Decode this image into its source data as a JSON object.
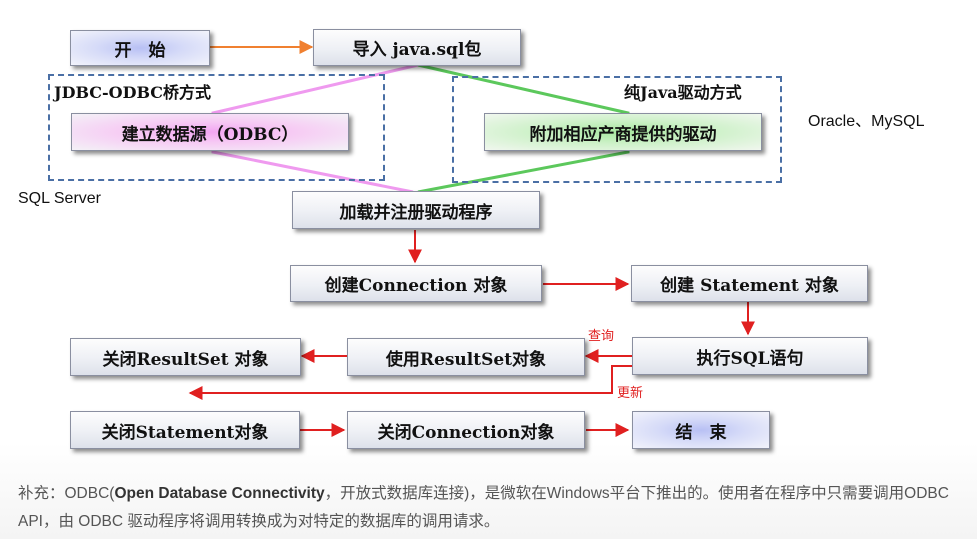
{
  "nodes": {
    "start": "开　始",
    "import": "导入 java.sql包",
    "odbc_source": "建立数据源（ODBC）",
    "vendor_driver": "附加相应产商提供的驱动",
    "load_driver": "加载并注册驱动程序",
    "create_connection": "创建Connection 对象",
    "create_statement": "创建 Statement 对象",
    "execute_sql": "执行SQL语句",
    "use_resultset": "使用ResultSet对象",
    "close_resultset": "关闭ResultSet 对象",
    "close_statement": "关闭Statement对象",
    "close_connection": "关闭Connection对象",
    "end": "结　束"
  },
  "groups": {
    "jdbc_odbc": "JDBC-ODBC桥方式",
    "pure_java": "纯Java驱动方式"
  },
  "side_labels": {
    "oracle_mysql": "Oracle、MySQL",
    "sql_server": "SQL Server"
  },
  "edge_labels": {
    "query": "查询",
    "update": "更新"
  },
  "note": {
    "prefix": "补充：ODBC(",
    "bold": "Open Database Connectivity",
    "suffix": "，开放式数据库连接)，是微软在Windows平台下推出的。使用者在程序中只需要调用ODBC API，由 ODBC 驱动程序将调用转换成为对特定的数据库的调用请求。"
  },
  "colors": {
    "arrow_red": "#e02020",
    "arrow_orange": "#f08030",
    "dash_blue": "#4a6fa5",
    "line_pink": "#ef9aef",
    "line_green": "#5cc85c"
  }
}
